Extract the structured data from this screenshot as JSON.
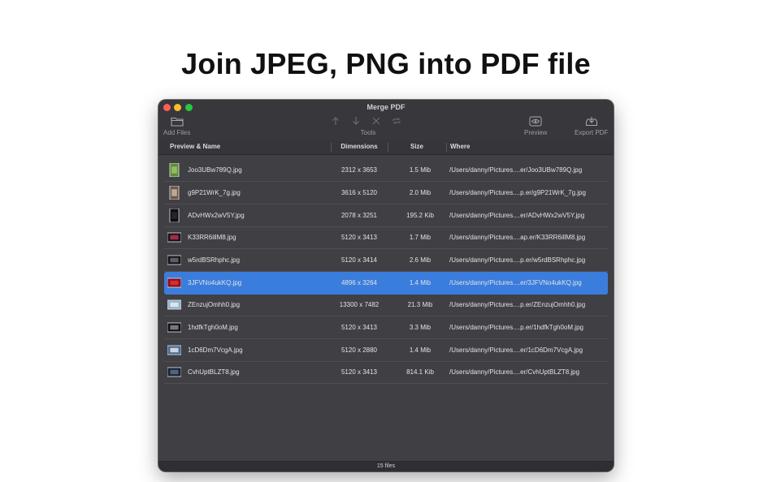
{
  "headline": "Join JPEG, PNG into PDF file",
  "window": {
    "title": "Merge PDF",
    "toolbar": {
      "add_files": "Add Files",
      "tools": "Tools",
      "preview": "Preview",
      "export_pdf": "Export PDF"
    }
  },
  "columns": {
    "name": "Preview & Name",
    "dimensions": "Dimensions",
    "size": "Size",
    "where": "Where"
  },
  "files": [
    {
      "name": "Joo3UBw789Q.jpg",
      "dimensions": "2312 x 3653",
      "size": "1.5 Mib",
      "where": "/Users/danny/Pictures....er/Joo3UBw789Q.jpg",
      "thumb": [
        "#5d8a3a",
        "#9cc46a"
      ],
      "orient": "portrait"
    },
    {
      "name": "g9P21WrK_7g.jpg",
      "dimensions": "3616 x 5120",
      "size": "2.0 Mib",
      "where": "/Users/danny/Pictures....p.er/g9P21WrK_7g.jpg",
      "thumb": [
        "#6b5a4a",
        "#c9b7a0"
      ],
      "orient": "portrait"
    },
    {
      "name": "ADvHWx2wV5Y.jpg",
      "dimensions": "2078 x 3251",
      "size": "195.2 Kib",
      "where": "/Users/danny/Pictures....er/ADvHWx2wV5Y.jpg",
      "thumb": [
        "#0d0d10",
        "#2a2a30"
      ],
      "orient": "portrait"
    },
    {
      "name": "K33RR6illM8.jpg",
      "dimensions": "5120 x 3413",
      "size": "1.7 Mib",
      "where": "/Users/danny/Pictures....ap.er/K33RR6illM8.jpg",
      "thumb": [
        "#1a1020",
        "#b8324a"
      ],
      "orient": "landscape"
    },
    {
      "name": "w5rdBSRhphc.jpg",
      "dimensions": "5120 x 3414",
      "size": "2.6 Mib",
      "where": "/Users/danny/Pictures....p.er/w5rdBSRhphc.jpg",
      "thumb": [
        "#141418",
        "#6a6a78"
      ],
      "orient": "landscape"
    },
    {
      "name": "3JFVNo4ukKQ.jpg",
      "dimensions": "4896 x 3264",
      "size": "1.4 Mib",
      "where": "/Users/danny/Pictures....er/3JFVNo4ukKQ.jpg",
      "thumb": [
        "#8a0e18",
        "#e2323c"
      ],
      "orient": "landscape"
    },
    {
      "name": "ZEnzujOmhh0.jpg",
      "dimensions": "13300 x 7482",
      "size": "21.3 Mib",
      "where": "/Users/danny/Pictures....p.er/ZEnzujOmhh0.jpg",
      "thumb": [
        "#8fb2cc",
        "#e8eef2"
      ],
      "orient": "landscape"
    },
    {
      "name": "1hdfkTgh0oM.jpg",
      "dimensions": "5120 x 3413",
      "size": "3.3 Mib",
      "where": "/Users/danny/Pictures....p.er/1hdfkTgh0oM.jpg",
      "thumb": [
        "#101014",
        "#8a8a92"
      ],
      "orient": "landscape"
    },
    {
      "name": "1cD6Dm7VcgA.jpg",
      "dimensions": "5120 x 2880",
      "size": "1.4 Mib",
      "where": "/Users/danny/Pictures....er/1cD6Dm7VcgA.jpg",
      "thumb": [
        "#4a6a90",
        "#dfe6ee"
      ],
      "orient": "landscape"
    },
    {
      "name": "CvhUptBLZT8.jpg",
      "dimensions": "5120 x 3413",
      "size": "814.1 Kib",
      "where": "/Users/danny/Pictures....er/CvhUptBLZT8.jpg",
      "thumb": [
        "#1a2030",
        "#5a7090"
      ],
      "orient": "landscape"
    }
  ],
  "selected_index": 5,
  "footer": {
    "count": "15 files"
  }
}
